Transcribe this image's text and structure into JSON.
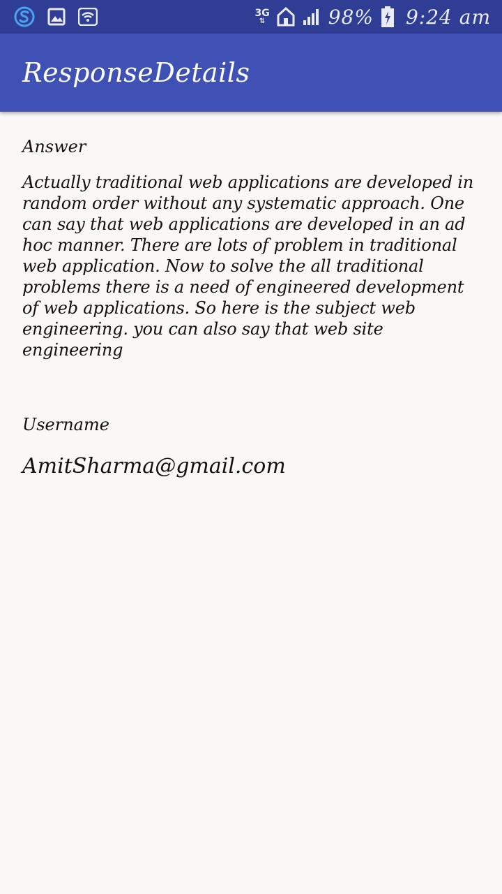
{
  "status_bar": {
    "icons_left": [
      "skype-icon",
      "image-icon",
      "wifi-icon"
    ],
    "network": "3G",
    "battery_percent": "98%",
    "time": "9:24 am",
    "bar_color": "#2f3d94"
  },
  "app_bar": {
    "title": "ResponseDetails",
    "color": "#3f51b5"
  },
  "response": {
    "answer_label": "Answer",
    "answer_text": "Actually traditional web applications are developed in random order without any systematic approach. One can say that web applications are developed in an ad hoc manner. There are lots of problem in traditional web application. Now to solve the all traditional problems there is a need of engineered development of web applications. So here is the subject web engineering. you can also say that web site engineering",
    "username_label": "Username",
    "username_value": "AmitSharma@gmail.com"
  }
}
